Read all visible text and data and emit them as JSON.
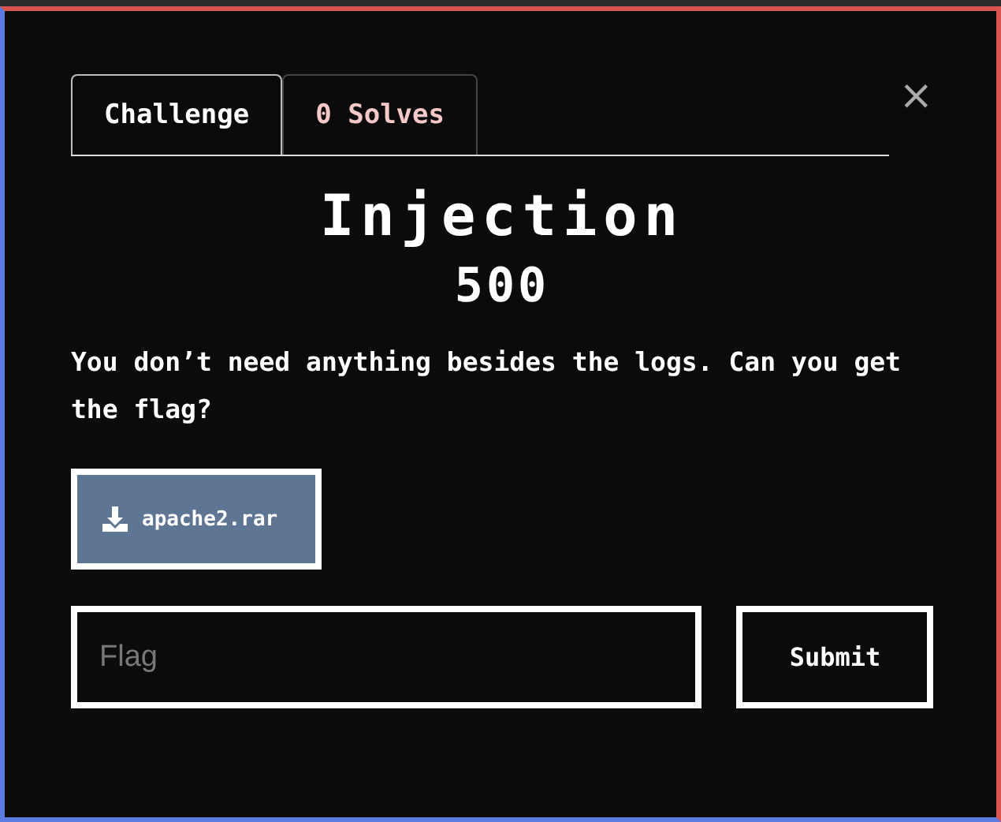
{
  "tabs": [
    {
      "label": "Challenge",
      "selected": true
    },
    {
      "label": "0 Solves",
      "selected": false
    }
  ],
  "close": {
    "glyph": "×"
  },
  "challenge": {
    "name": "Injection",
    "value": "500",
    "description": "You don’t need anything besides the logs. Can you get the flag?"
  },
  "files": [
    {
      "name": "apache2.rar"
    }
  ],
  "flag_input": {
    "placeholder": "Flag"
  },
  "submit": {
    "label": "Submit"
  }
}
